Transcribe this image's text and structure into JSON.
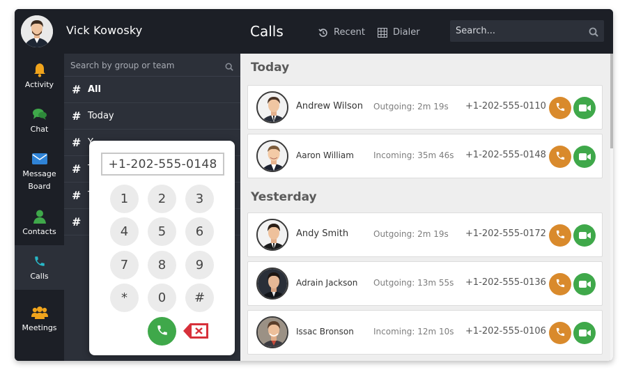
{
  "user": {
    "name": "Vick Kowosky"
  },
  "header": {
    "title": "Calls",
    "tabs": [
      {
        "label": "Recent",
        "icon": "history-icon"
      },
      {
        "label": "Dialer",
        "icon": "keypad-icon"
      }
    ],
    "search_placeholder": "Search..."
  },
  "nav": {
    "items": [
      {
        "label": "Activity",
        "icon": "bell-icon"
      },
      {
        "label": "Chat",
        "icon": "chat-bubbles-icon"
      },
      {
        "label_line1": "Message",
        "label_line2": "Board",
        "icon": "envelope-icon"
      },
      {
        "label": "Contacts",
        "icon": "person-icon"
      },
      {
        "label": "Calls",
        "icon": "phone-icon",
        "active": true
      },
      {
        "label": "Meetings",
        "icon": "group-icon"
      }
    ]
  },
  "groups": {
    "search_placeholder": "Search by group or team",
    "items": [
      {
        "label": "All"
      },
      {
        "label": "Today"
      },
      {
        "label": "Y"
      },
      {
        "label": "T"
      },
      {
        "label": "T"
      },
      {
        "label": ""
      }
    ]
  },
  "dialer": {
    "display": "+1-202-555-0148",
    "keys": [
      "1",
      "2",
      "3",
      "4",
      "5",
      "6",
      "7",
      "8",
      "9",
      "*",
      "0",
      "#"
    ]
  },
  "sections": [
    {
      "title": "Today",
      "calls": [
        {
          "name": "Andrew Wilson",
          "duration": "Outgoing: 2m 19s",
          "phone": "+1-202-555-0110"
        },
        {
          "name": "Aaron William",
          "duration": "Incoming: 35m 46s",
          "phone": "+1-202-555-0148"
        }
      ]
    },
    {
      "title": "Yesterday",
      "calls": [
        {
          "name": "Andy Smith",
          "duration": "Outgoing: 2m 19s",
          "phone": "+1-202-555-0172"
        },
        {
          "name": "Adrain Jackson",
          "duration": "Outgoing: 13m 55s",
          "phone": "+1-202-555-0136"
        },
        {
          "name": "Issac Bronson",
          "duration": "Incoming: 12m 10s",
          "phone": "+1-202-555-0106"
        }
      ]
    }
  ],
  "colors": {
    "sidebar": "#1c1f26",
    "panel": "#2c3039",
    "call_button": "#d98a2c",
    "video_button": "#3fa84a",
    "bell": "#f0a41c",
    "chat": "#3fa84a",
    "envelope": "#2f83d6",
    "contacts": "#3fa84a",
    "calls": "#28b8c8",
    "meetings": "#f0a41c"
  }
}
